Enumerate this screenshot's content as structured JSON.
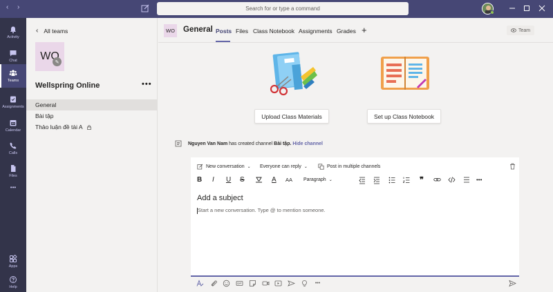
{
  "titlebar": {
    "search_placeholder": "Search for or type a command",
    "back_glyph": "‹",
    "forward_glyph": "›"
  },
  "rail": {
    "items": [
      {
        "label": "Activity",
        "icon": "bell-icon"
      },
      {
        "label": "Chat",
        "icon": "chat-icon"
      },
      {
        "label": "Teams",
        "icon": "teams-icon",
        "active": true
      },
      {
        "label": "Assignments",
        "icon": "assignments-icon"
      },
      {
        "label": "Calendar",
        "icon": "calendar-icon"
      },
      {
        "label": "Calls",
        "icon": "phone-icon"
      },
      {
        "label": "Files",
        "icon": "file-icon"
      },
      {
        "label": "Apps",
        "icon": "apps-icon"
      },
      {
        "label": "Help",
        "icon": "help-icon"
      }
    ],
    "more_glyph": "•••"
  },
  "panel": {
    "back_label": "All teams",
    "team_initials": "WO",
    "team_name": "Wellspring Online",
    "more_glyph": "•••",
    "channels": [
      {
        "label": "General",
        "active": true
      },
      {
        "label": "Bài tập"
      },
      {
        "label": "Thảo luận đề tài A",
        "locked": true
      }
    ]
  },
  "header": {
    "channel_initials": "WO",
    "channel_title": "General",
    "tabs": [
      "Posts",
      "Files",
      "Class Notebook",
      "Assignments",
      "Grades"
    ],
    "add_tab_glyph": "+",
    "team_button": "Team"
  },
  "actions": {
    "upload": "Upload Class Materials",
    "notebook": "Set up Class Notebook"
  },
  "system_message": {
    "user": "Nguyen Van Nam",
    "middle": "has created channel",
    "channel": "Bài tập.",
    "link": "Hide channel"
  },
  "composer": {
    "new_conversation": "New conversation",
    "audience": "Everyone can reply",
    "multi_channel": "Post in multiple channels",
    "paragraph": "Paragraph",
    "subject_placeholder": "Add a subject",
    "body_placeholder": "Start a new conversation. Type @ to mention someone.",
    "fmt": {
      "bold": "B",
      "italic": "I",
      "underline": "U",
      "strike": "S",
      "font_color": "A",
      "font_size": "AA",
      "quote": "❞",
      "more": "•••"
    },
    "bottom_more": "•••"
  },
  "colors": {
    "accent": "#6264a7",
    "titlebar": "#464775",
    "rail": "#33344a",
    "status_available": "#92c353"
  }
}
